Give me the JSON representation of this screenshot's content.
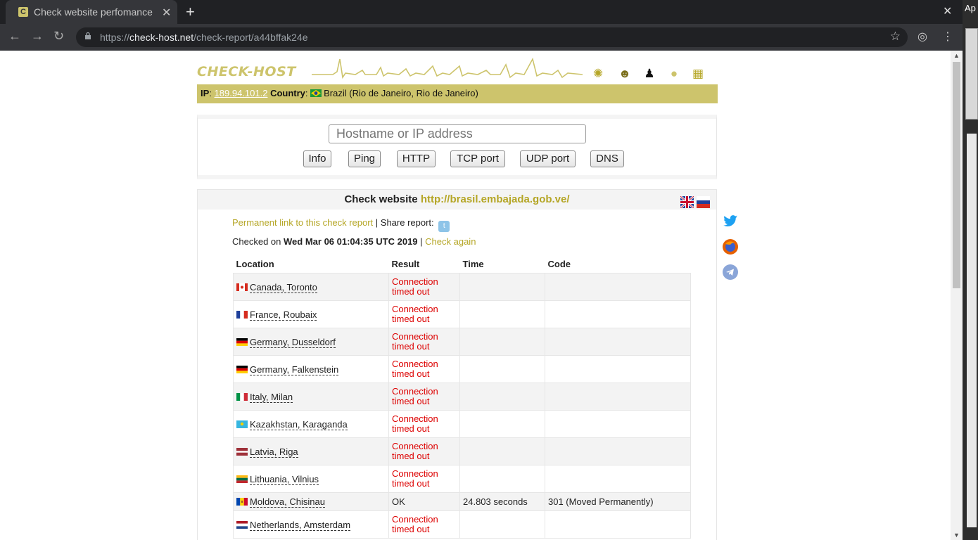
{
  "browser": {
    "tab_title": "Check website perfomance",
    "url_scheme": "https://",
    "url_host": "check-host.net",
    "url_path": "/check-report/a44bffak24e",
    "desktop_label": "Ap"
  },
  "site": {
    "logo_text": "CHECK-HOST",
    "os_icons": [
      "android-icon",
      "bsd-icon",
      "linux-icon",
      "apple-icon",
      "windows-icon"
    ]
  },
  "ipbar": {
    "ip_label": "IP",
    "ip_value": "189.94.101.2",
    "country_label": "Country",
    "country_value": "Brazil (Rio de Janeiro, Rio de Janeiro)"
  },
  "form": {
    "placeholder": "Hostname or IP address",
    "buttons": [
      "Info",
      "Ping",
      "HTTP",
      "TCP port",
      "UDP port",
      "DNS"
    ]
  },
  "report": {
    "heading_prefix": "Check website",
    "target": "http://brasil.embajada.gob.ve/",
    "permanent_link": "Permanent link to this check report",
    "share_label": "| Share report:",
    "checked_on_label": "Checked on",
    "checked_on_value": "Wed Mar 06 01:04:35 UTC 2019",
    "check_again": "Check again",
    "columns": [
      "Location",
      "Result",
      "Time",
      "Code"
    ],
    "rows": [
      {
        "flag": "ca",
        "location": "Canada, Toronto",
        "result": "Connection timed out",
        "time": "",
        "code": ""
      },
      {
        "flag": "fr",
        "location": "France, Roubaix",
        "result": "Connection timed out",
        "time": "",
        "code": ""
      },
      {
        "flag": "de",
        "location": "Germany, Dusseldorf",
        "result": "Connection timed out",
        "time": "",
        "code": ""
      },
      {
        "flag": "de",
        "location": "Germany, Falkenstein",
        "result": "Connection timed out",
        "time": "",
        "code": ""
      },
      {
        "flag": "it",
        "location": "Italy, Milan",
        "result": "Connection timed out",
        "time": "",
        "code": ""
      },
      {
        "flag": "kz",
        "location": "Kazakhstan, Karaganda",
        "result": "Connection timed out",
        "time": "",
        "code": ""
      },
      {
        "flag": "lv",
        "location": "Latvia, Riga",
        "result": "Connection timed out",
        "time": "",
        "code": ""
      },
      {
        "flag": "lt",
        "location": "Lithuania, Vilnius",
        "result": "Connection timed out",
        "time": "",
        "code": ""
      },
      {
        "flag": "md",
        "location": "Moldova, Chisinau",
        "result": "OK",
        "time": "24.803 seconds",
        "code": "301 (Moved Permanently)"
      },
      {
        "flag": "nl",
        "location": "Netherlands, Amsterdam",
        "result": "Connection timed out",
        "time": "",
        "code": ""
      }
    ]
  },
  "colors": {
    "brand": "#cdc46c",
    "link": "#b5a626",
    "error": "#dd0000"
  }
}
